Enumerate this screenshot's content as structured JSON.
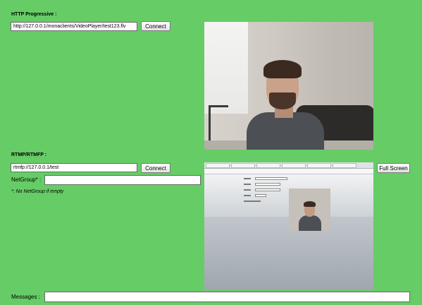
{
  "http": {
    "section_title": "HTTP Progressive :",
    "url_value": "http://127.0.0.1/monaclients/VideoPlayer/test123.flv",
    "connect_label": "Connect"
  },
  "rtmp": {
    "section_title": "RTMP/RTMFP :",
    "url_value": "rtmfp://127.0.0.1/test",
    "connect_label": "Connect",
    "netgroup_label": "NetGroup* :",
    "netgroup_value": "",
    "netgroup_hint": "*: No NetGroup if empty",
    "fullscreen_label": "Full Screen"
  },
  "messages": {
    "label": "Messages :",
    "value": ""
  },
  "colors": {
    "background": "#66cc66"
  }
}
